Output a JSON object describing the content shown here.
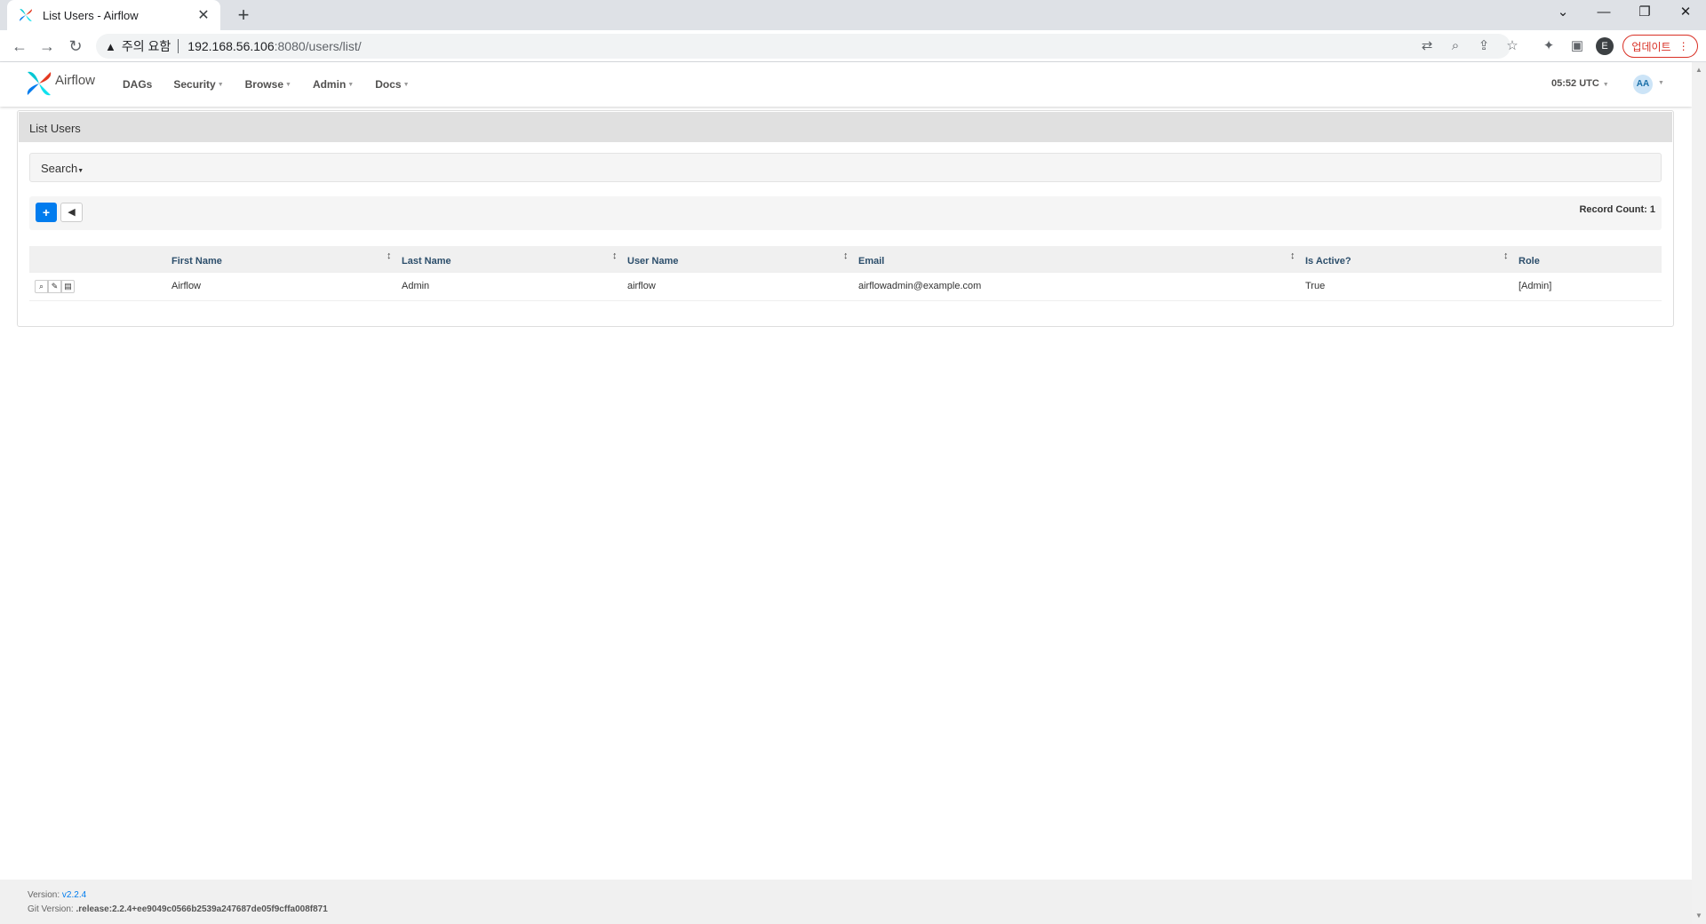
{
  "browser": {
    "tab_title": "List Users - Airflow",
    "tab_close": "✕",
    "new_tab": "+",
    "security_warning": "주의 요함",
    "url_host": "192.168.56.106",
    "url_rest": ":8080/users/list/",
    "profile_initial": "E",
    "update_label": "업데이트",
    "update_menu": "⋮"
  },
  "app": {
    "brand": "Airflow",
    "menu": [
      {
        "label": "DAGs",
        "dropdown": false
      },
      {
        "label": "Security",
        "dropdown": true
      },
      {
        "label": "Browse",
        "dropdown": true
      },
      {
        "label": "Admin",
        "dropdown": true
      },
      {
        "label": "Docs",
        "dropdown": true
      }
    ],
    "clock": "05:52 UTC",
    "user_initials": "AA",
    "colors": {
      "accent": "#017cee",
      "header_text": "#2c4e6b"
    }
  },
  "page": {
    "title": "List Users",
    "search_label": "Search",
    "record_count": "Record Count: 1"
  },
  "table": {
    "columns": [
      "First Name",
      "Last Name",
      "User Name",
      "Email",
      "Is Active?",
      "Role"
    ],
    "rows": [
      {
        "first_name": "Airflow",
        "last_name": "Admin",
        "user_name": "airflow",
        "email": "airflowadmin@example.com",
        "is_active": "True",
        "role": "[Admin]"
      }
    ]
  },
  "footer": {
    "version_label": "Version:",
    "version": "v2.2.4",
    "git_label": "Git Version:",
    "git_version": ".release:2.2.4+ee9049c0566b2539a247687de05f9cffa008f871"
  }
}
